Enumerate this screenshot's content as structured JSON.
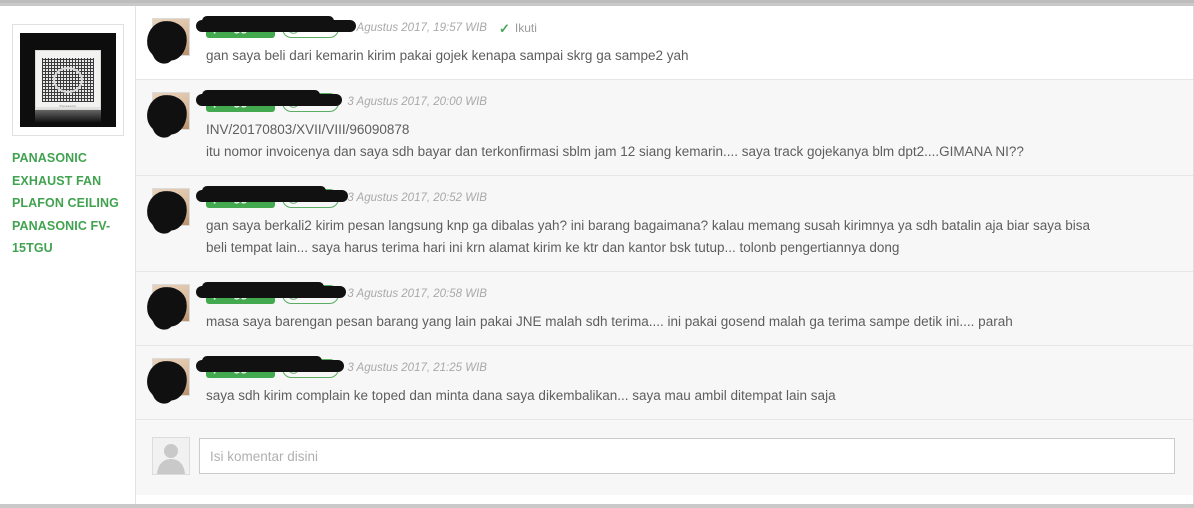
{
  "product": {
    "title": "PANASONIC EXHAUST FAN PLAFON CEILING PANASONIC FV-15TGU",
    "image_alt": "panasonic-exhaust-fan-thumbnail",
    "brand_label": "Panasonic",
    "title_color": "#41a350"
  },
  "labels": {
    "user_badge": "pengguna",
    "reputation": "100%",
    "follow": "Ikuti",
    "smiley_icon": "smiley-icon",
    "check_icon": "check-icon"
  },
  "comments": [
    {
      "user_badge": "pengguna",
      "reputation": "100%",
      "timestamp": "3 Agustus 2017, 19:57 WIB",
      "follow": "Ikuti",
      "has_follow": true,
      "lines": [
        "gan saya beli dari kemarin kirim pakai gojek kenapa sampai skrg ga sampe2 yah"
      ]
    },
    {
      "user_badge": "pengguna",
      "reputation": "100%",
      "timestamp": "3 Agustus 2017, 20:00 WIB",
      "follow": "",
      "has_follow": false,
      "lines": [
        "INV/20170803/XVII/VIII/96090878",
        "itu nomor invoicenya dan saya sdh bayar dan terkonfirmasi sblm jam 12 siang kemarin.... saya track gojekanya blm dpt2....GIMANA NI??"
      ]
    },
    {
      "user_badge": "pengguna",
      "reputation": "100%",
      "timestamp": "3 Agustus 2017, 20:52 WIB",
      "follow": "",
      "has_follow": false,
      "lines": [
        "gan saya berkali2 kirim pesan langsung knp ga dibalas yah? ini barang bagaimana? kalau memang susah kirimnya ya sdh batalin aja biar saya bisa",
        "beli tempat lain... saya harus terima hari ini krn alamat kirim ke ktr dan kantor bsk tutup... tolonb pengertiannya dong"
      ]
    },
    {
      "user_badge": "pengguna",
      "reputation": "100%",
      "timestamp": "3 Agustus 2017, 20:58 WIB",
      "follow": "",
      "has_follow": false,
      "lines": [
        "masa saya barengan pesan barang yang lain pakai JNE malah sdh terima.... ini pakai gosend malah ga terima sampe detik ini.... parah"
      ]
    },
    {
      "user_badge": "pengguna",
      "reputation": "100%",
      "timestamp": "3 Agustus 2017, 21:25 WIB",
      "follow": "",
      "has_follow": false,
      "lines": [
        "saya sdh kirim complain ke toped dan minta dana saya dikembalikan... saya mau ambil ditempat lain saja"
      ]
    }
  ],
  "comment_form": {
    "placeholder": "Isi komentar disini",
    "value": "",
    "avatar_icon": "default-avatar-icon"
  }
}
